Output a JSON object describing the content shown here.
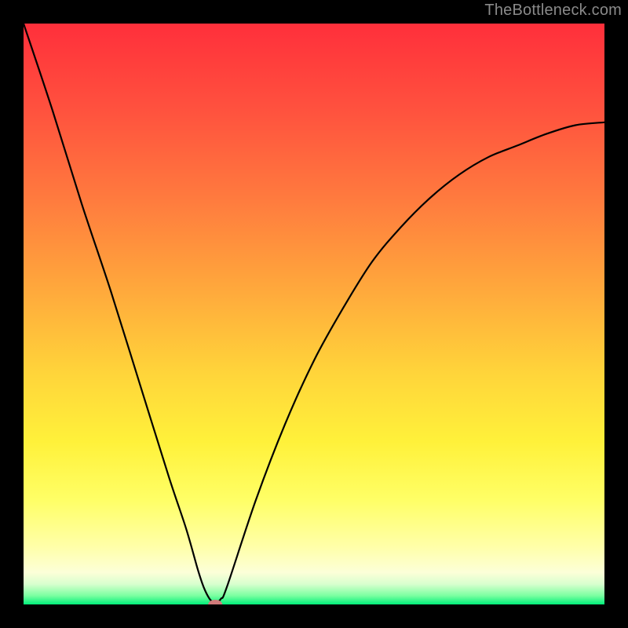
{
  "watermark": "TheBottleneck.com",
  "chart_data": {
    "type": "line",
    "title": "",
    "xlabel": "",
    "ylabel": "",
    "xlim": [
      0,
      100
    ],
    "ylim": [
      0,
      100
    ],
    "x": [
      0,
      5,
      10,
      15,
      20,
      25,
      28,
      30,
      31,
      32,
      33,
      34,
      35,
      40,
      45,
      50,
      55,
      60,
      65,
      70,
      75,
      80,
      85,
      90,
      95,
      100
    ],
    "values": [
      100,
      85,
      69,
      54,
      38,
      22,
      13,
      6,
      3,
      1,
      0,
      1,
      3,
      18,
      31,
      42,
      51,
      59,
      65,
      70,
      74,
      77,
      79,
      81,
      82.5,
      83
    ],
    "annotations": [
      {
        "type": "cusp_marker",
        "x": 33,
        "y": 0,
        "color": "#d07a7a"
      }
    ],
    "background_gradient": {
      "stops": [
        {
          "offset": 0.0,
          "color": "#ff2f3b"
        },
        {
          "offset": 0.15,
          "color": "#ff523e"
        },
        {
          "offset": 0.3,
          "color": "#ff7a3e"
        },
        {
          "offset": 0.45,
          "color": "#ffa63c"
        },
        {
          "offset": 0.6,
          "color": "#ffd43a"
        },
        {
          "offset": 0.72,
          "color": "#fff13a"
        },
        {
          "offset": 0.82,
          "color": "#ffff66"
        },
        {
          "offset": 0.9,
          "color": "#ffffa8"
        },
        {
          "offset": 0.945,
          "color": "#fcffd8"
        },
        {
          "offset": 0.965,
          "color": "#d8ffce"
        },
        {
          "offset": 0.985,
          "color": "#7affa0"
        },
        {
          "offset": 1.0,
          "color": "#00ef7a"
        }
      ]
    },
    "curve_color": "#000000",
    "marker_color": "#d07a7a"
  }
}
